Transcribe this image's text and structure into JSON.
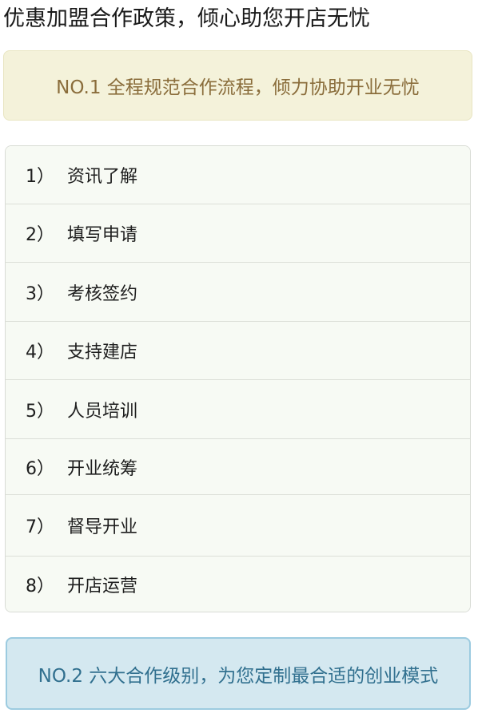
{
  "page": {
    "title": "优惠加盟合作政策，倾心助您开店无忧"
  },
  "banner1": {
    "text": "NO.1 全程规范合作流程，倾力协助开业无忧"
  },
  "steps": [
    {
      "num": "1）",
      "label": "资讯了解"
    },
    {
      "num": "2）",
      "label": "填写申请"
    },
    {
      "num": "3）",
      "label": "考核签约"
    },
    {
      "num": "4）",
      "label": "支持建店"
    },
    {
      "num": "5）",
      "label": "人员培训"
    },
    {
      "num": "6）",
      "label": "开业统筹"
    },
    {
      "num": "7）",
      "label": "督导开业"
    },
    {
      "num": "8）",
      "label": "开店运营"
    }
  ],
  "banner2": {
    "text": "NO.2 六大合作级别，为您定制最合适的创业模式"
  },
  "colors": {
    "banner1_bg": "#f4f2da",
    "banner1_text": "#8a6d3b",
    "banner2_bg": "#d4e8f0",
    "banner2_text": "#31708f",
    "list_bg": "#f7faf4"
  }
}
